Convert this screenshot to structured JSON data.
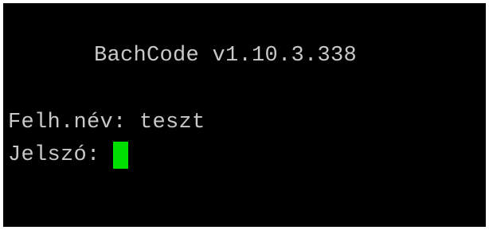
{
  "terminal": {
    "background": "#000000",
    "text_color": "#c8c8c8",
    "cursor_color": "#00e000",
    "title": "BachCode v1.10.3.338",
    "username_label": "Felh.név:",
    "username_value": "teszt",
    "password_label": "Jelszó:",
    "password_value": ""
  }
}
